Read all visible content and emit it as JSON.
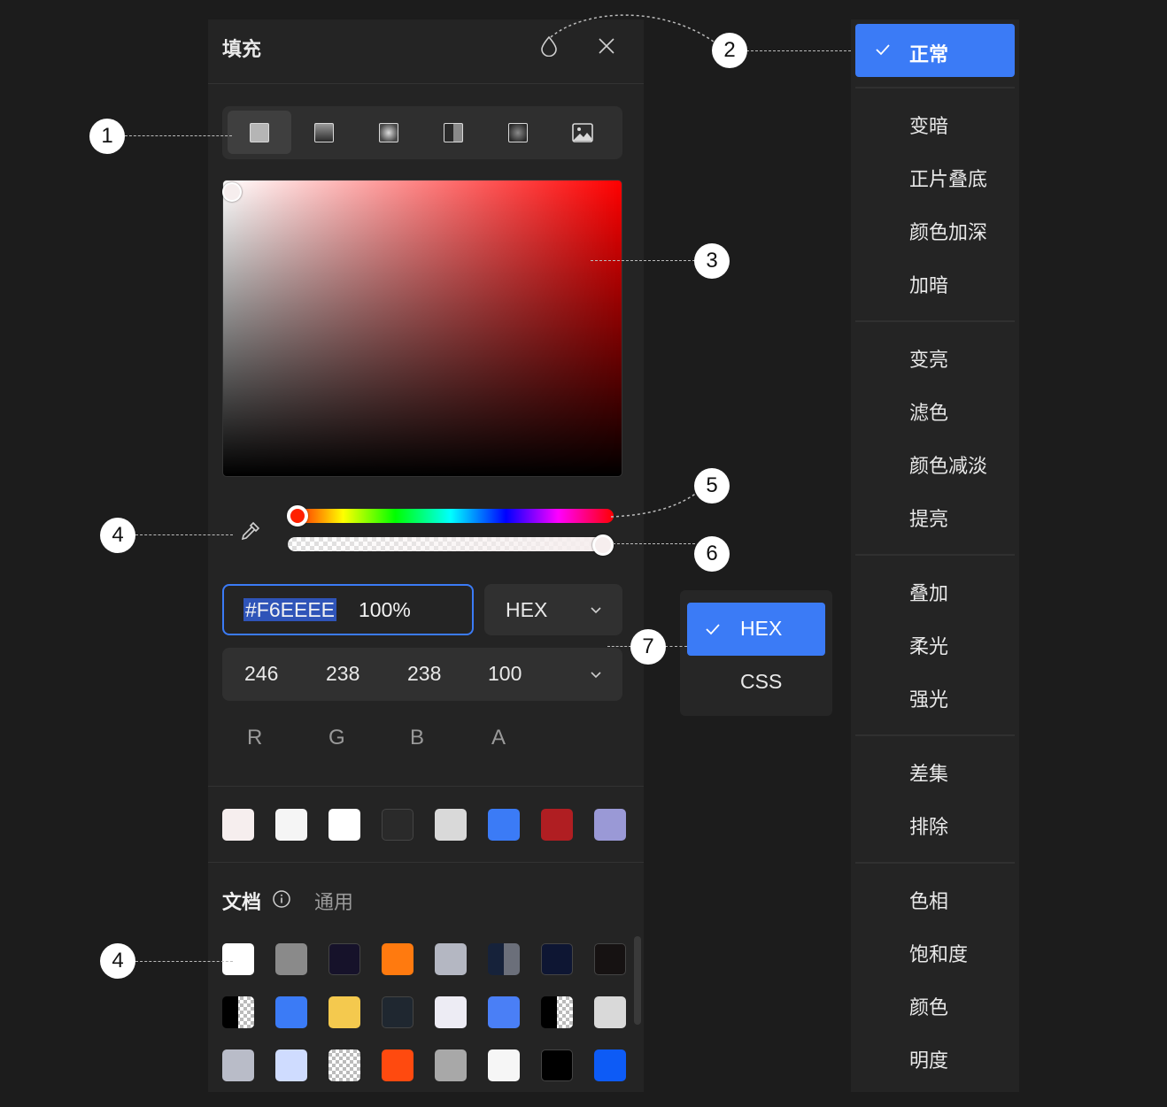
{
  "panel": {
    "title": "填充",
    "fill_types": [
      "solid",
      "linear-gradient",
      "radial-gradient",
      "angular-gradient",
      "diamond-gradient",
      "image"
    ],
    "picker": {
      "hex_value": "#F6EEEE",
      "alpha_value": "100%",
      "format_selected": "HEX",
      "rgba": [
        {
          "value": "246",
          "label": "R"
        },
        {
          "value": "238",
          "label": "G"
        },
        {
          "value": "238",
          "label": "B"
        },
        {
          "value": "100",
          "label": "A"
        }
      ]
    },
    "recent_colors": [
      "#F6EEEE",
      "#F5F5F5",
      "#FFFFFF",
      "#2A2A2A",
      "#D9D9D9",
      "#3B7BF6",
      "#B01E22",
      "#9A99D6"
    ],
    "library": {
      "tab_document": "文档",
      "tab_common": "通用",
      "swatches": [
        [
          "#FFFFFF",
          "#8A8A8A",
          "#16122A",
          "#FF7A0F",
          "#B4B7C2",
          "split-dark",
          "#0E1633",
          "#161212"
        ],
        [
          "split-black",
          "#3B7BF6",
          "#F4C94E",
          "#1F2730",
          "#EDECF4",
          "#4A7FF6",
          "split-black",
          "#D9D9D9"
        ],
        [
          "#B9BCC8",
          "#CFDCFF",
          "checker",
          "#FF4A0F",
          "#A8A8A8",
          "#F6F6F6",
          "#000000",
          "#0D5BF6"
        ]
      ]
    }
  },
  "blend_menu": {
    "selected": "正常",
    "groups": [
      [
        "变暗",
        "正片叠底",
        "颜色加深",
        "加暗"
      ],
      [
        "变亮",
        "滤色",
        "颜色减淡",
        "提亮"
      ],
      [
        "叠加",
        "柔光",
        "强光"
      ],
      [
        "差集",
        "排除"
      ],
      [
        "色相",
        "饱和度",
        "颜色",
        "明度"
      ]
    ]
  },
  "format_menu": {
    "selected": "HEX",
    "other": "CSS"
  },
  "callouts": [
    "1",
    "2",
    "3",
    "4",
    "5",
    "6",
    "7",
    "4"
  ],
  "colors": {
    "accent": "#3B7BF6",
    "panel_bg": "#242424",
    "page_bg": "#1C1C1C"
  }
}
